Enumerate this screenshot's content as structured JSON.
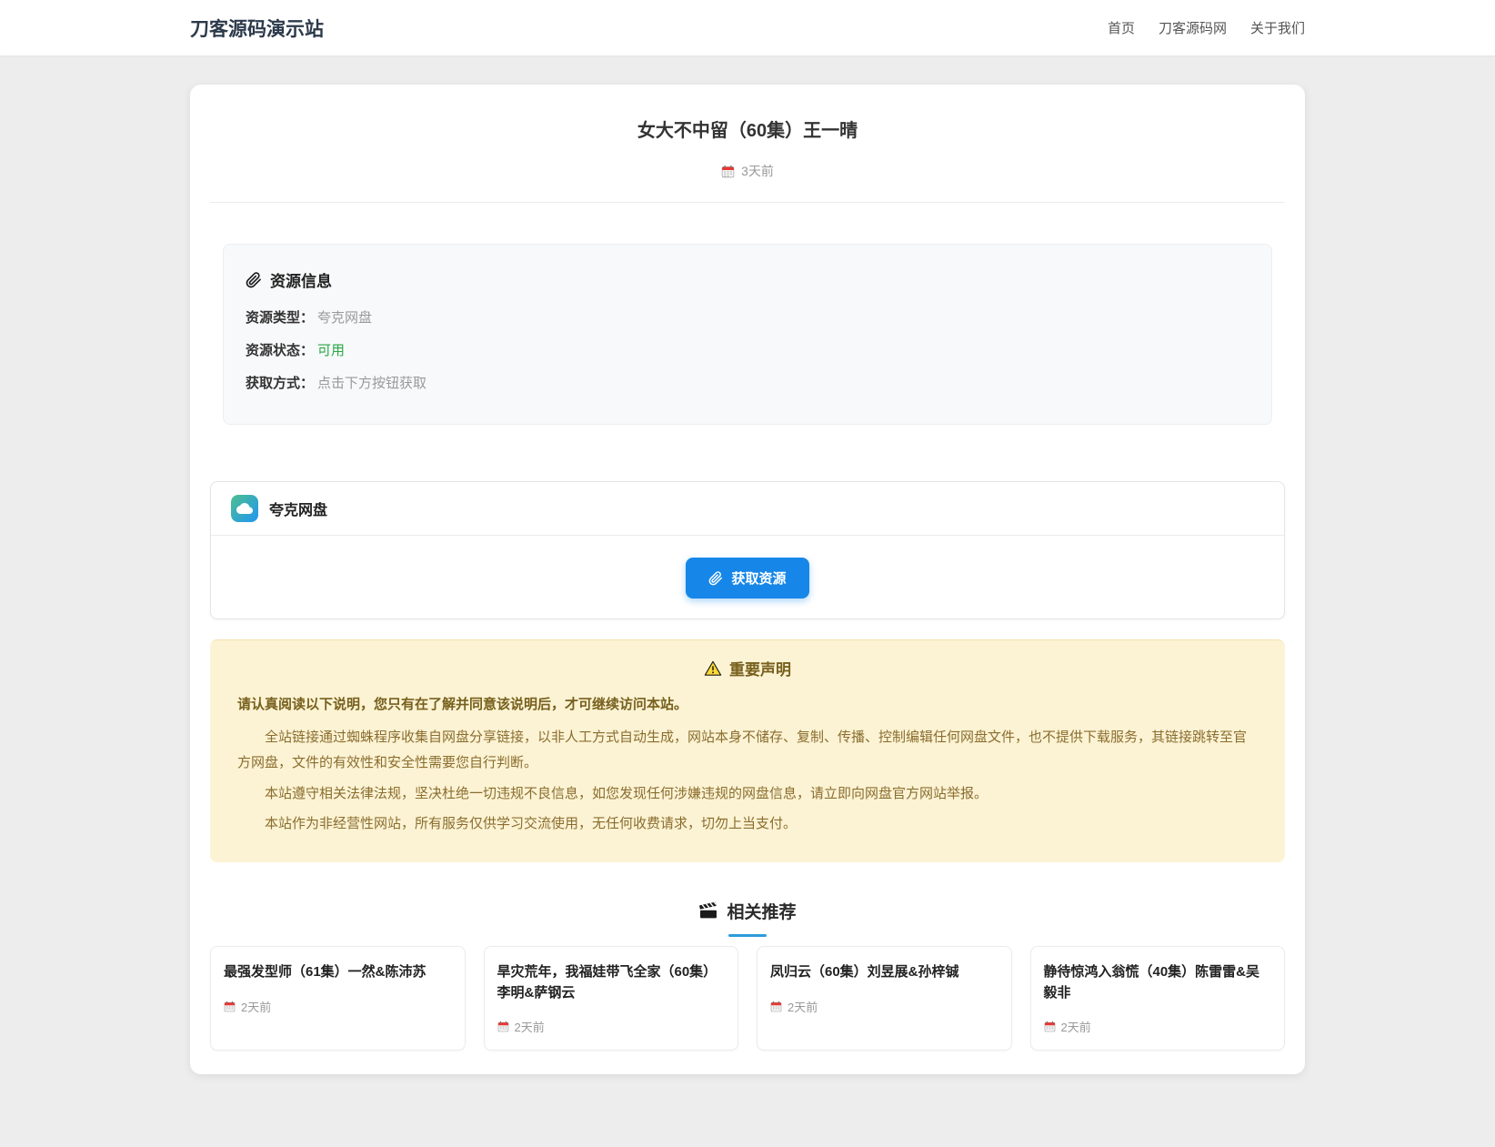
{
  "header": {
    "site_title": "刀客源码演示站",
    "nav": [
      {
        "label": "首页"
      },
      {
        "label": "刀客源码网"
      },
      {
        "label": "关于我们"
      }
    ]
  },
  "post": {
    "title": "女大不中留（60集）王一晴",
    "date": "3天前"
  },
  "resource_info": {
    "heading": "资源信息",
    "rows": [
      {
        "label": "资源类型：",
        "value": "夸克网盘"
      },
      {
        "label": "资源状态：",
        "value": "可用"
      },
      {
        "label": "获取方式：",
        "value": "点击下方按钮获取"
      }
    ]
  },
  "netdisk": {
    "name": "夸克网盘",
    "button_label": "获取资源"
  },
  "notice": {
    "heading": "重要声明",
    "intro": "请认真阅读以下说明，您只有在了解并同意该说明后，才可继续访问本站。",
    "paragraphs": [
      "全站链接通过蜘蛛程序收集自网盘分享链接，以非人工方式自动生成，网站本身不储存、复制、传播、控制编辑任何网盘文件，也不提供下载服务，其链接跳转至官方网盘，文件的有效性和安全性需要您自行判断。",
      "本站遵守相关法律法规，坚决杜绝一切违规不良信息，如您发现任何涉嫌违规的网盘信息，请立即向网盘官方网站举报。",
      "本站作为非经营性网站，所有服务仅供学习交流使用，无任何收费请求，切勿上当支付。"
    ]
  },
  "related": {
    "heading": "相关推荐",
    "items": [
      {
        "title": "最强发型师（61集）一然&陈沛苏",
        "date": "2天前"
      },
      {
        "title": "旱灾荒年，我福娃带飞全家（60集）李明&萨钢云",
        "date": "2天前"
      },
      {
        "title": "凤归云（60集）刘昱展&孙梓铖",
        "date": "2天前"
      },
      {
        "title": "静待惊鸿入翁慌（40集）陈雷雷&吴毅非",
        "date": "2天前"
      }
    ]
  },
  "colors": {
    "accent_blue": "#1687e8",
    "status_green": "#28a745",
    "warning_bg": "#fcf3d4",
    "warning_text": "#8a6d2e",
    "underline_blue": "#2d9cdb"
  }
}
